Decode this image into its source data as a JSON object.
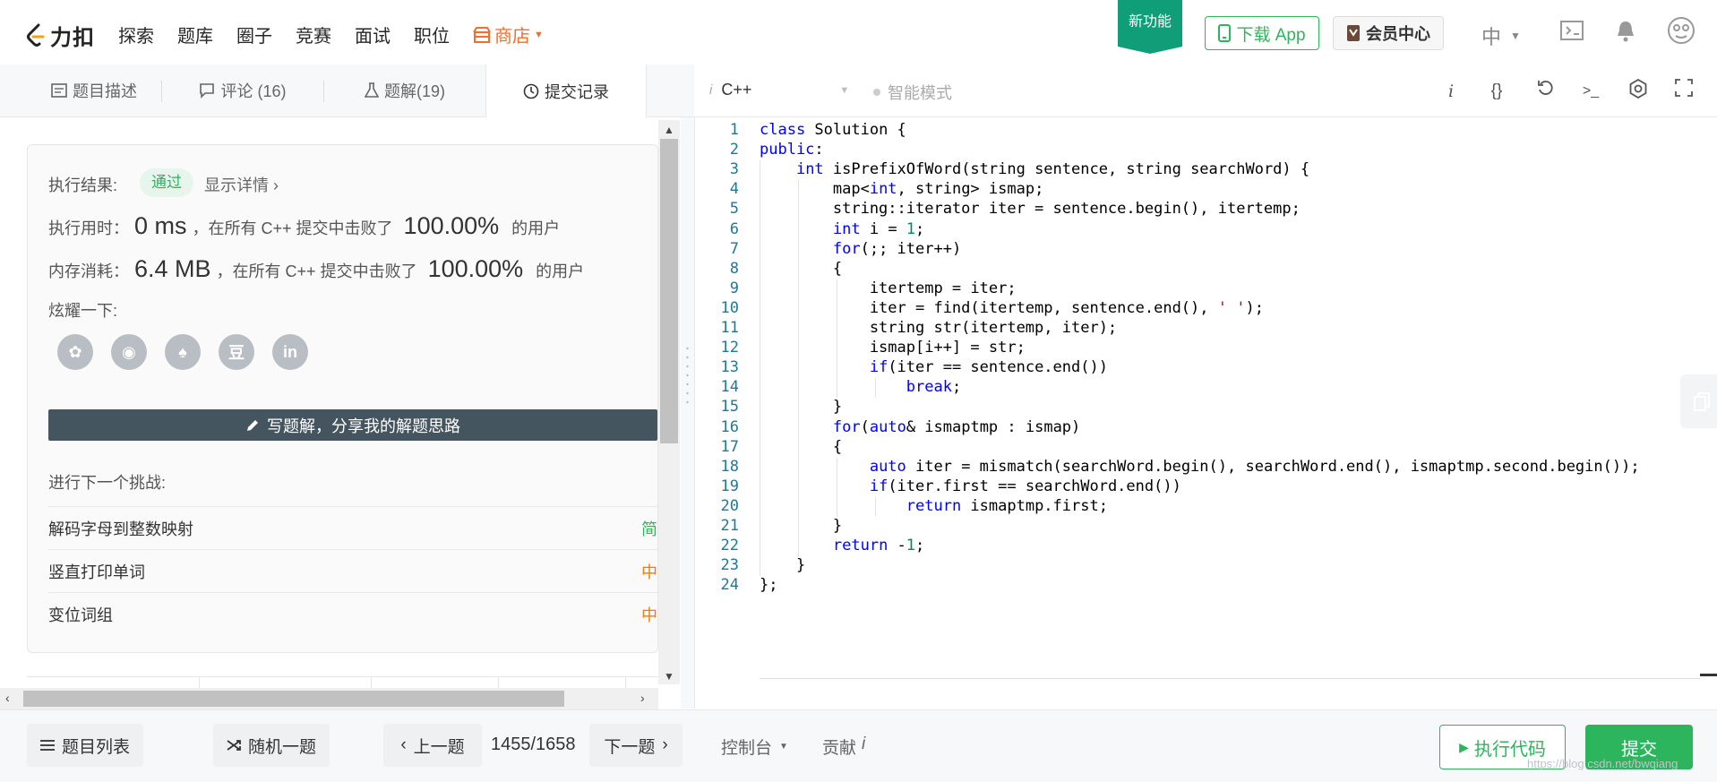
{
  "brand": {
    "name": "力扣"
  },
  "nav": {
    "items": [
      "探索",
      "题库",
      "圈子",
      "竞赛",
      "面试",
      "职位"
    ],
    "shop": "商店",
    "new_feature": "新功能",
    "download_app": "下载 App",
    "vip_center": "会员中心",
    "language": "中"
  },
  "tabs": [
    {
      "label": "题目描述",
      "icon": "doc-icon"
    },
    {
      "label": "评论 (16)",
      "icon": "comment-icon"
    },
    {
      "label": "题解(19)",
      "icon": "flask-icon"
    },
    {
      "label": "提交记录",
      "icon": "clock-icon"
    }
  ],
  "editor_bar": {
    "language": "C++",
    "smart_mode": "智能模式",
    "info": "i"
  },
  "result": {
    "label": "执行结果:",
    "status": "通过",
    "detail_link": "显示详情 ›",
    "time_label": "执行用时：",
    "time_value": "0 ms",
    "time_desc": "，在所有 C++ 提交中击败了",
    "time_pct": "100.00%",
    "time_suffix": "的用户",
    "mem_label": "内存消耗：",
    "mem_value": "6.4 MB",
    "mem_desc": "，在所有 C++ 提交中击败了",
    "mem_pct": "100.00%",
    "mem_suffix": "的用户",
    "share_label": "炫耀一下:",
    "share_icons": [
      "wechat-icon",
      "weibo-icon",
      "qq-icon",
      "douban-icon",
      "linkedin-icon"
    ],
    "share_glyphs": [
      "✿",
      "◉",
      "♠",
      "豆",
      "in"
    ],
    "write_solution": "写题解，分享我的解题思路",
    "next_label": "进行下一个挑战:",
    "challenges": [
      {
        "title": "解码字母到整数映射",
        "difficulty": "简"
      },
      {
        "title": "竖直打印单词",
        "difficulty": "中"
      },
      {
        "title": "变位词组",
        "difficulty": "中"
      }
    ]
  },
  "code": {
    "lines": [
      "class Solution {",
      "public:",
      "    int isPrefixOfWord(string sentence, string searchWord) {",
      "        map<int, string> ismap;",
      "        string::iterator iter = sentence.begin(), itertemp;",
      "        int i = 1;",
      "        for(;; iter++)",
      "        {",
      "            itertemp = iter;",
      "            iter = find(itertemp, sentence.end(), ' ');",
      "            string str(itertemp, iter);",
      "            ismap[i++] = str;",
      "            if(iter == sentence.end())",
      "                break;",
      "        }",
      "        for(auto& ismaptmp : ismap)",
      "        {",
      "            auto iter = mismatch(searchWord.begin(), searchWord.end(), ismaptmp.second.begin());",
      "            if(iter.first == searchWord.end())",
      "                return ismaptmp.first;",
      "        }",
      "        return -1;",
      "    }",
      "};"
    ]
  },
  "bottom": {
    "problem_list": "题目列表",
    "random": "随机一题",
    "prev": "上一题",
    "page": "1455/1658",
    "next": "下一题",
    "console": "控制台",
    "contribute": "贡献",
    "contribute_icon": "i",
    "run": "执行代码",
    "submit": "提交",
    "watermark": "https://blog.csdn.net/bwqiang"
  },
  "colors": {
    "accent": "#2db55d",
    "shop": "#f56c2d",
    "new_feature": "#0f9e78",
    "write_bar": "#455560"
  }
}
